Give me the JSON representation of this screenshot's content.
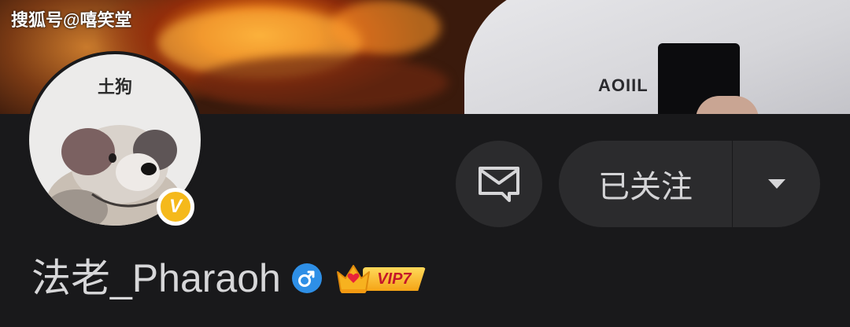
{
  "watermark": "搜狐号@嘻笑堂",
  "cover": {
    "print_text": "AOIIL"
  },
  "avatar": {
    "caption": "土狗",
    "verified_badge": "V"
  },
  "actions": {
    "message_icon": "envelope-icon",
    "follow_label": "已关注",
    "dropdown_icon": "triangle-down-icon"
  },
  "profile": {
    "username": "法老_Pharaoh",
    "gender_icon": "male-icon",
    "vip_label": "VIP7"
  },
  "colors": {
    "background": "#19191b",
    "button": "#2b2b2d",
    "verified": "#f5b91b",
    "gender": "#2e8fe6",
    "vip_gold": "#f5a416",
    "vip_text": "#c4162a"
  }
}
